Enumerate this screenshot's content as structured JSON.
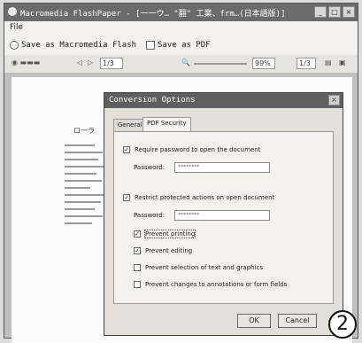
{
  "window": {
    "title": "Macromedia FlashPaper - [一一ウ… \"翻\" 工業、frm…(日本語版)]",
    "min_label": "_",
    "max_label": "□",
    "close_label": "×"
  },
  "menu": {
    "file_label": "File"
  },
  "pdf_toolbar": {
    "save_flash_label": "Save as Macromedia Flash",
    "save_pdf_label": "Save as PDF"
  },
  "nav_toolbar": {
    "page_label": "1/3",
    "zoom_value": "99%",
    "range_value": "1/3"
  },
  "document": {
    "heading": "ロ一ラ"
  },
  "dialog": {
    "title": "Conversion Options",
    "close_label": "×",
    "tabs": [
      {
        "label": "General"
      },
      {
        "label": "PDF Security"
      }
    ],
    "require_open_label": "Require password to open the document",
    "open_password_label": "Password:",
    "open_password_value": "********",
    "restrict_label": "Restrict protected actions on open document",
    "restrict_password_label": "Password:",
    "restrict_password_value": "********",
    "options": [
      {
        "label": "Prevent printing",
        "checked": true
      },
      {
        "label": "Prevent editing",
        "checked": true
      },
      {
        "label": "Prevent selection of text and graphics",
        "checked": false
      },
      {
        "label": "Prevent changes to annotations or form fields",
        "checked": false
      }
    ],
    "check_mark": "✓",
    "ok_label": "OK",
    "cancel_label": "Cancel"
  },
  "badge": {
    "number": "2"
  }
}
